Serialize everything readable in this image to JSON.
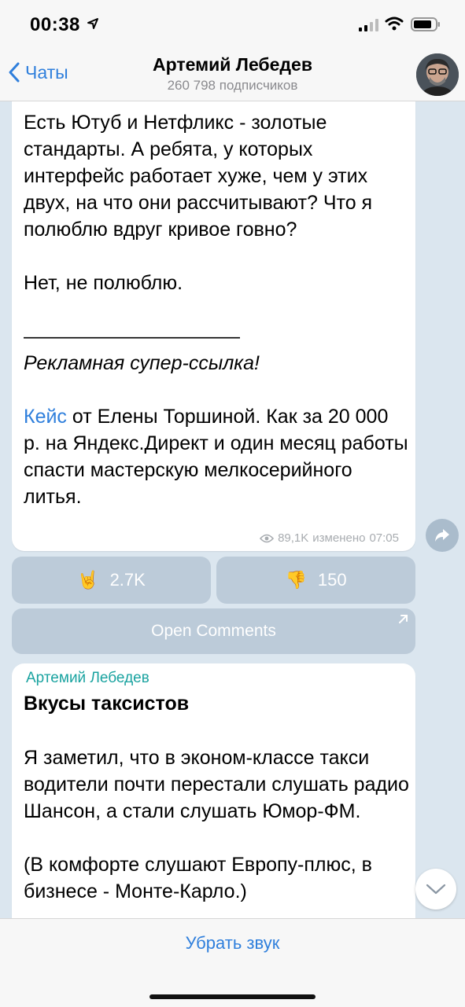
{
  "status_bar": {
    "time": "00:38"
  },
  "nav": {
    "back_label": "Чаты",
    "title": "Артемий Лебедев",
    "subtitle": "260 798 подписчиков"
  },
  "post1": {
    "paragraph1": "Есть Ютуб и Нетфликс - золотые стандарты. А ребята, у которых интерфейс работает хуже, чем у этих двух, на что они рассчитывают? Что я полюблю вдруг кривое говно?",
    "paragraph2": "Нет, не полюблю.",
    "separator": "———————————",
    "ad_label": "Рекламная супер-ссылка!",
    "link_text": "Кейс",
    "paragraph3_rest": " от Елены Торшиной. Как за 20 000 р. на Яндекс.Директ и один месяц работы спасти мастерскую мелкосерийного литья.",
    "views": "89,1K",
    "edited_label": "изменено",
    "edited_time": "07:05"
  },
  "reactions": [
    {
      "emoji": "🤘",
      "count": "2.7K"
    },
    {
      "emoji": "👎",
      "count": "150"
    }
  ],
  "open_comments_label": "Open Comments",
  "post2": {
    "author": "Артемий Лебедев",
    "title": "Вкусы таксистов",
    "paragraph1": "Я заметил, что в эконом-классе такси водители почти перестали слушать радио Шансон, а стали слушать Юмор-ФМ.",
    "paragraph2": "(В комфорте слушают Европу-плюс, в бизнесе - Монте-Карло.)"
  },
  "bottom": {
    "mute_label": "Убрать звук"
  },
  "colors": {
    "accent": "#2f7fdc",
    "author": "#1aa3a0",
    "chat_bg": "#dbe6ef"
  }
}
